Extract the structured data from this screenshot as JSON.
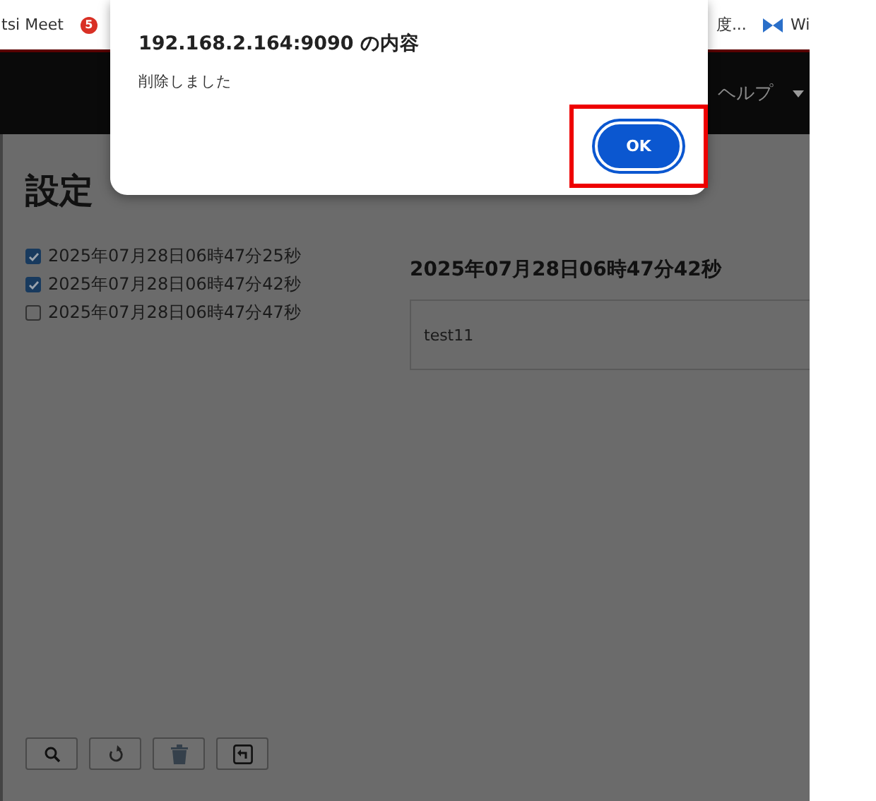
{
  "bookmarks": [
    {
      "label": "tsi Meet",
      "kind": "text"
    },
    {
      "label": "5",
      "kind": "badge"
    },
    {
      "label": "度...",
      "kind": "text"
    },
    {
      "label": "Wi",
      "kind": "star"
    }
  ],
  "header": {
    "menu": [
      {
        "label": "ヘルプ"
      }
    ]
  },
  "page": {
    "title": "設定",
    "files": [
      {
        "label": "2025年07月28日06時47分25秒",
        "checked": true
      },
      {
        "label": "2025年07月28日06時47分42秒",
        "checked": true
      },
      {
        "label": "2025年07月28日06時47分47秒",
        "checked": false
      }
    ],
    "detail": {
      "heading": "2025年07月28日06時47分42秒",
      "content": "test11"
    },
    "toolbar": [
      {
        "kind": "search"
      },
      {
        "kind": "refresh"
      },
      {
        "kind": "trash"
      },
      {
        "kind": "undo"
      }
    ]
  },
  "dialog": {
    "title": "192.168.2.164:9090 の内容",
    "message": "削除しました",
    "buttons": [
      {
        "label": "OK",
        "highlighted": true
      }
    ]
  }
}
